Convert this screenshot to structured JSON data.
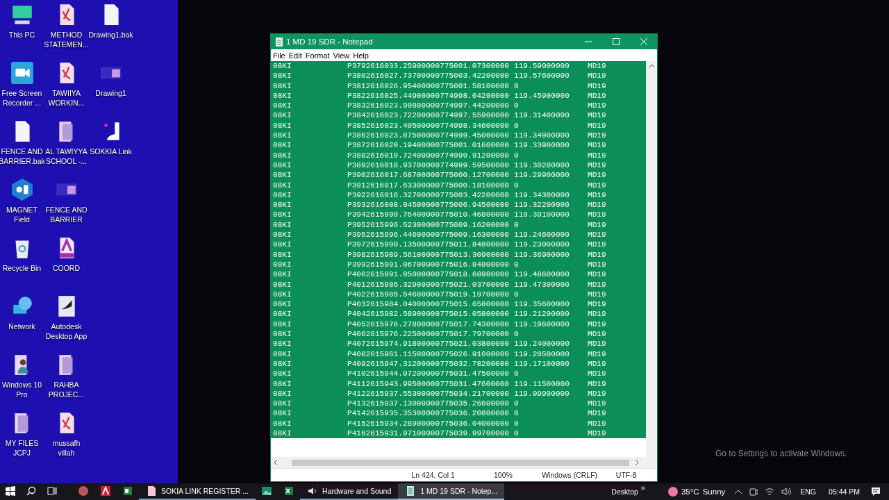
{
  "desktop_icons": [
    {
      "label": "This PC",
      "kind": "pc"
    },
    {
      "label": "METHOD STATEMEN...",
      "kind": "pdf"
    },
    {
      "label": "Drawing1.bak",
      "kind": "file"
    },
    {
      "label": "Free Screen Recorder ...",
      "kind": "recorder"
    },
    {
      "label": "TAWIIYA WORKIN...",
      "kind": "pdf"
    },
    {
      "label": "Drawing1",
      "kind": "image"
    },
    {
      "label": "FENCE AND BARRIER.bak",
      "kind": "file"
    },
    {
      "label": "AL TAWIYYA SCHOOL -...",
      "kind": "folder"
    },
    {
      "label": "SOKKIA Link",
      "kind": "app"
    },
    {
      "label": "MAGNET Field",
      "kind": "magnet"
    },
    {
      "label": "FENCE AND BARRIER",
      "kind": "image"
    },
    {
      "kind": "none"
    },
    {
      "label": "Recycle Bin",
      "kind": "recycle"
    },
    {
      "label": "COORD",
      "kind": "lsp"
    },
    {
      "kind": "none"
    },
    {
      "label": "Network",
      "kind": "network"
    },
    {
      "label": "Autodesk Desktop App",
      "kind": "ada"
    },
    {
      "kind": "none"
    },
    {
      "label": "Windows 10 Pro",
      "kind": "user"
    },
    {
      "label": "RAHBA PROJEC...",
      "kind": "folder"
    },
    {
      "kind": "none"
    },
    {
      "label": "MY FILES JCPJ",
      "kind": "folder"
    },
    {
      "label": "mussafh villah",
      "kind": "pdf"
    }
  ],
  "notepad": {
    "title": "1 MD 19 SDR - Notepad",
    "menu": [
      "File",
      "Edit",
      "Format",
      "View",
      "Help"
    ],
    "lines": [
      [
        "08KI",
        "P3792616033.25900000775001.07300000",
        "119.59000000",
        "MD19"
      ],
      [
        "08KI",
        "P3802616027.73700000775003.42200000",
        "119.57600000",
        "MD19"
      ],
      [
        "08KI",
        "P3812616026.95400000775001.58100000",
        "0",
        "MD19"
      ],
      [
        "08KI",
        "P3822616025.44900000774998.04200000",
        "119.45900000",
        "MD19"
      ],
      [
        "08KI",
        "P3832616023.99800000774997.44200000",
        "0",
        "MD19"
      ],
      [
        "08KI",
        "P3842616023.72200000774997.55900000",
        "119.31400000",
        "MD19"
      ],
      [
        "08KI",
        "P3852616023.40500000774998.34600000",
        "0",
        "MD19"
      ],
      [
        "08KI",
        "P3862616023.87500000774999.45000000",
        "119.34900000",
        "MD19"
      ],
      [
        "08KI",
        "P3872616020.19400000775001.01600000",
        "119.33900000",
        "MD19"
      ],
      [
        "08KI",
        "P3882616019.72400000774999.91200000",
        "0",
        "MD19"
      ],
      [
        "08KI",
        "P3892616018.93700000774999.59500000",
        "119.30200000",
        "MD19"
      ],
      [
        "08KI",
        "P3902616017.68700000775000.12700000",
        "119.29900000",
        "MD19"
      ],
      [
        "08KI",
        "P3912616017.63300000775000.18100000",
        "0",
        "MD19"
      ],
      [
        "08KI",
        "P3922616016.32700000775003.42200000",
        "119.34300000",
        "MD19"
      ],
      [
        "08KI",
        "P3932616008.04500000775006.94500000",
        "119.32200000",
        "MD19"
      ],
      [
        "08KI",
        "P3942615999.76400000775010.46800000",
        "119.30100000",
        "MD19"
      ],
      [
        "08KI",
        "P3952615996.52300000775009.16200000",
        "0",
        "MD19"
      ],
      [
        "08KI",
        "P3962615996.44600000775009.16300000",
        "119.24600000",
        "MD19"
      ],
      [
        "08KI",
        "P3972615990.13500000775011.84800000",
        "119.23000000",
        "MD19"
      ],
      [
        "08KI",
        "P3982615989.56100000775013.30900000",
        "119.36900000",
        "MD19"
      ],
      [
        "08KI",
        "P3992615991.06700000775016.84800000",
        "0",
        "MD19"
      ],
      [
        "08KI",
        "P4002615991.85000000775018.68900000",
        "119.48600000",
        "MD19"
      ],
      [
        "08KI",
        "P4012615986.32900000775021.03700000",
        "119.47300000",
        "MD19"
      ],
      [
        "08KI",
        "P4022615985.54600000775019.19700000",
        "0",
        "MD19"
      ],
      [
        "08KI",
        "P4032615984.04000000775015.65800000",
        "119.35600000",
        "MD19"
      ],
      [
        "08KI",
        "P4042615982.58900000775015.05800000",
        "119.21200000",
        "MD19"
      ],
      [
        "08KI",
        "P4052615976.27800000775017.74300000",
        "119.19600000",
        "MD19"
      ],
      [
        "08KI",
        "P4062615976.22500000775017.79700000",
        "0",
        "MD19"
      ],
      [
        "08KI",
        "P4072615974.91800000775021.03800000",
        "119.24000000",
        "MD19"
      ],
      [
        "08KI",
        "P4082615961.11500000775026.91000000",
        "119.20500000",
        "MD19"
      ],
      [
        "08KI",
        "P4092615947.31200000775032.78200000",
        "119.17100000",
        "MD19"
      ],
      [
        "08KI",
        "P4102615944.07200000775031.47500000",
        "0",
        "MD19"
      ],
      [
        "08KI",
        "P4112615943.99500000775031.47600000",
        "119.11500000",
        "MD19"
      ],
      [
        "08KI",
        "P4122615937.55300000775034.21700000",
        "119.09900000",
        "MD19"
      ],
      [
        "08KI",
        "P4132615937.13000000775035.26600000",
        "0",
        "MD19"
      ],
      [
        "08KI",
        "P4142615935.35300000775036.20800000",
        "0",
        "MD19"
      ],
      [
        "08KI",
        "P4152615934.28900000775036.04000000",
        "0",
        "MD19"
      ],
      [
        "08KI",
        "P4162615931.97100000775039.99700000",
        "0",
        "MD19"
      ]
    ],
    "status": [
      "Ln 424, Col 1",
      "100%",
      "Windows (CRLF)",
      "UTF-8"
    ]
  },
  "activation_notice": "Go to Settings to activate Windows.",
  "taskbar": {
    "apps": [
      {
        "kind": "chrome",
        "selected": false
      },
      {
        "kind": "cad",
        "selected": false
      },
      {
        "kind": "word",
        "selected": false
      },
      {
        "kind": "pdf",
        "label": "SOKIA LINK REGISTER ...",
        "selected": false
      },
      {
        "kind": "photos",
        "selected": false
      },
      {
        "kind": "excel",
        "selected": false
      },
      {
        "kind": "settings",
        "label": "Hardware and Sound",
        "selected": false
      },
      {
        "kind": "notepad",
        "label": "1 MD 19 SDR - Notep...",
        "selected": true
      }
    ],
    "desktop_label": "Desktop",
    "overflow": "»",
    "temperature": "35°C",
    "weather": "Sunny",
    "language": "ENG",
    "time": "05:44 PM"
  }
}
